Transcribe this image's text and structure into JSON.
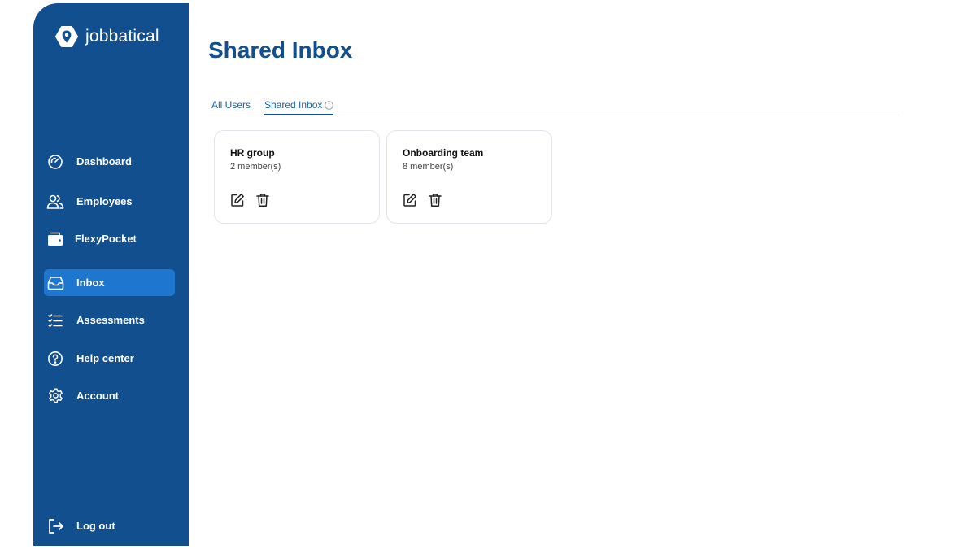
{
  "brand": {
    "name": "jobbatical"
  },
  "sidebar": {
    "items": [
      {
        "label": "Dashboard",
        "icon": "gauge-icon"
      },
      {
        "label": "Employees",
        "icon": "users-icon"
      },
      {
        "label": "FlexyPocket",
        "icon": "wallet-icon"
      },
      {
        "label": "Inbox",
        "icon": "inbox-icon",
        "active": true
      },
      {
        "label": "Assessments",
        "icon": "checklist-icon"
      },
      {
        "label": "Help center",
        "icon": "help-icon"
      },
      {
        "label": "Account",
        "icon": "gear-icon"
      }
    ],
    "logout": {
      "label": "Log out",
      "icon": "logout-icon"
    }
  },
  "main": {
    "title": "Shared Inbox",
    "tabs": [
      {
        "label": "All Users",
        "active": false
      },
      {
        "label": "Shared Inbox",
        "active": true,
        "icon": "info-icon"
      }
    ],
    "groups": [
      {
        "name": "HR group",
        "members": "2 member(s)"
      },
      {
        "name": "Onboarding team",
        "members": "8 member(s)"
      }
    ]
  },
  "colors": {
    "sidebar_bg": "#124f8e",
    "active_nav_bg": "#1f76cf",
    "title": "#124f8e",
    "tab_text": "#1c63ae"
  }
}
